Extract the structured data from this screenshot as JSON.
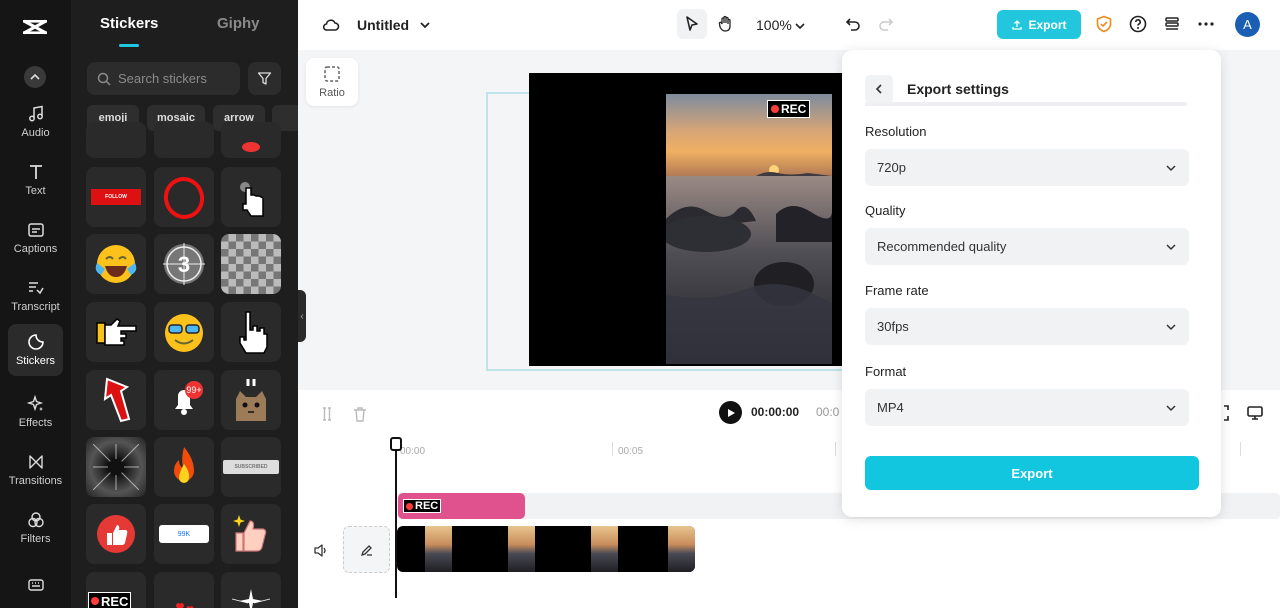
{
  "rail": {
    "items": [
      {
        "label": "Audio",
        "icon": "music-note-icon"
      },
      {
        "label": "Text",
        "icon": "text-icon"
      },
      {
        "label": "Captions",
        "icon": "captions-icon"
      },
      {
        "label": "Transcript",
        "icon": "transcript-icon"
      },
      {
        "label": "Stickers",
        "icon": "stickers-icon",
        "active": true
      },
      {
        "label": "Effects",
        "icon": "sparkle-icon"
      },
      {
        "label": "Transitions",
        "icon": "transitions-icon"
      },
      {
        "label": "Filters",
        "icon": "filters-icon"
      }
    ]
  },
  "panel": {
    "tabs": [
      "Stickers",
      "Giphy"
    ],
    "search_placeholder": "Search stickers",
    "chips": [
      "emoji",
      "mosaic",
      "arrow"
    ],
    "sticker_text": {
      "follow": "FOLLOW",
      "countdown": "3",
      "badge": "99+",
      "subscribed": "SUBSCRIBED",
      "likes": "99K",
      "rec": "REC"
    }
  },
  "topbar": {
    "project_title": "Untitled",
    "zoom": "100%",
    "export_label": "Export",
    "avatar_letter": "A"
  },
  "canvas": {
    "ratio_label": "Ratio",
    "rec_label": "REC"
  },
  "playback": {
    "current_time": "00:00:00",
    "total_time_partial": "00:0"
  },
  "timeline": {
    "ticks": [
      "00:00",
      "00:05"
    ],
    "rec_clip_label": "REC"
  },
  "export_settings": {
    "title": "Export settings",
    "fields": [
      {
        "label": "Resolution",
        "value": "720p"
      },
      {
        "label": "Quality",
        "value": "Recommended quality"
      },
      {
        "label": "Frame rate",
        "value": "30fps"
      },
      {
        "label": "Format",
        "value": "MP4"
      }
    ],
    "export_label": "Export"
  },
  "colors": {
    "accent": "#22c7de",
    "rec_clip": "#e0528d",
    "rail_bg": "#151515",
    "panel_bg": "#1e1e1e"
  }
}
